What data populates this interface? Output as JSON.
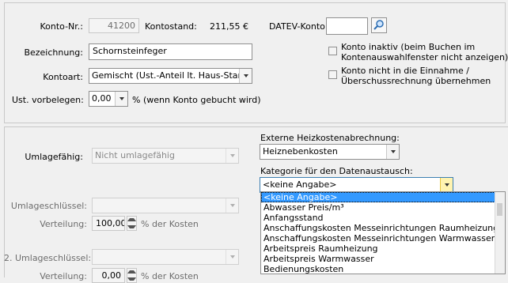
{
  "konto": {
    "nr_label": "Konto-Nr.:",
    "nr_value": "41200",
    "kontostand_label": "Kontostand:",
    "kontostand_value": "211,55 €",
    "datev_label": "DATEV-Konto:",
    "datev_value": "",
    "bezeichnung_label": "Bezeichnung:",
    "bezeichnung_value": "Schornsteinfeger",
    "kontoart_label": "Kontoart:",
    "kontoart_value": "Gemischt (Ust.-Anteil lt. Haus-Stammdat",
    "ust_label": "Ust. vorbelegen:",
    "ust_value": "0,00",
    "ust_suffix": "%  (wenn Konto gebucht wird)",
    "inaktiv_label": "Konto inaktiv (beim Buchen im\nKontenauswahlfenster nicht anzeigen)",
    "nicht_eur_label": "Konto nicht in die Einnahme /\nÜberschussrechnung übernehmen"
  },
  "umlage": {
    "umlagefaehig_label": "Umlagefähig:",
    "umlagefaehig_value": "Nicht umlagefähig",
    "schluessel_label": "Umlageschlüssel:",
    "schluessel_value": "",
    "verteilung_label": "Verteilung:",
    "verteilung_value": "100,00",
    "verteilung_suffix": "% der Kosten",
    "schluessel2_label": "2. Umlageschlüssel:",
    "schluessel2_value": "",
    "verteilung2_label": "Verteilung:",
    "verteilung2_value": "0,00",
    "verteilung2_suffix": "% der Kosten"
  },
  "heizkosten": {
    "ext_label": "Externe Heizkostenabrechnung:",
    "ext_value": "Heiznebenkosten",
    "kategorie_label": "Kategorie für den Datenaustausch:",
    "kategorie_value": "<keine Angabe>",
    "options": [
      "<keine Angabe>",
      "Abwasser Preis/m³",
      "Anfangsstand",
      "Anschaffungskosten Messeinrichtungen Raumheizung",
      "Anschaffungskosten Messeinrichtungen Warmwasser",
      "Arbeitspreis Raumheizung",
      "Arbeitspreis Warmwasser",
      "Bedienungskosten"
    ]
  },
  "icons": {
    "search": "magnifier-icon",
    "dropdown": "chevron-down-icon"
  }
}
